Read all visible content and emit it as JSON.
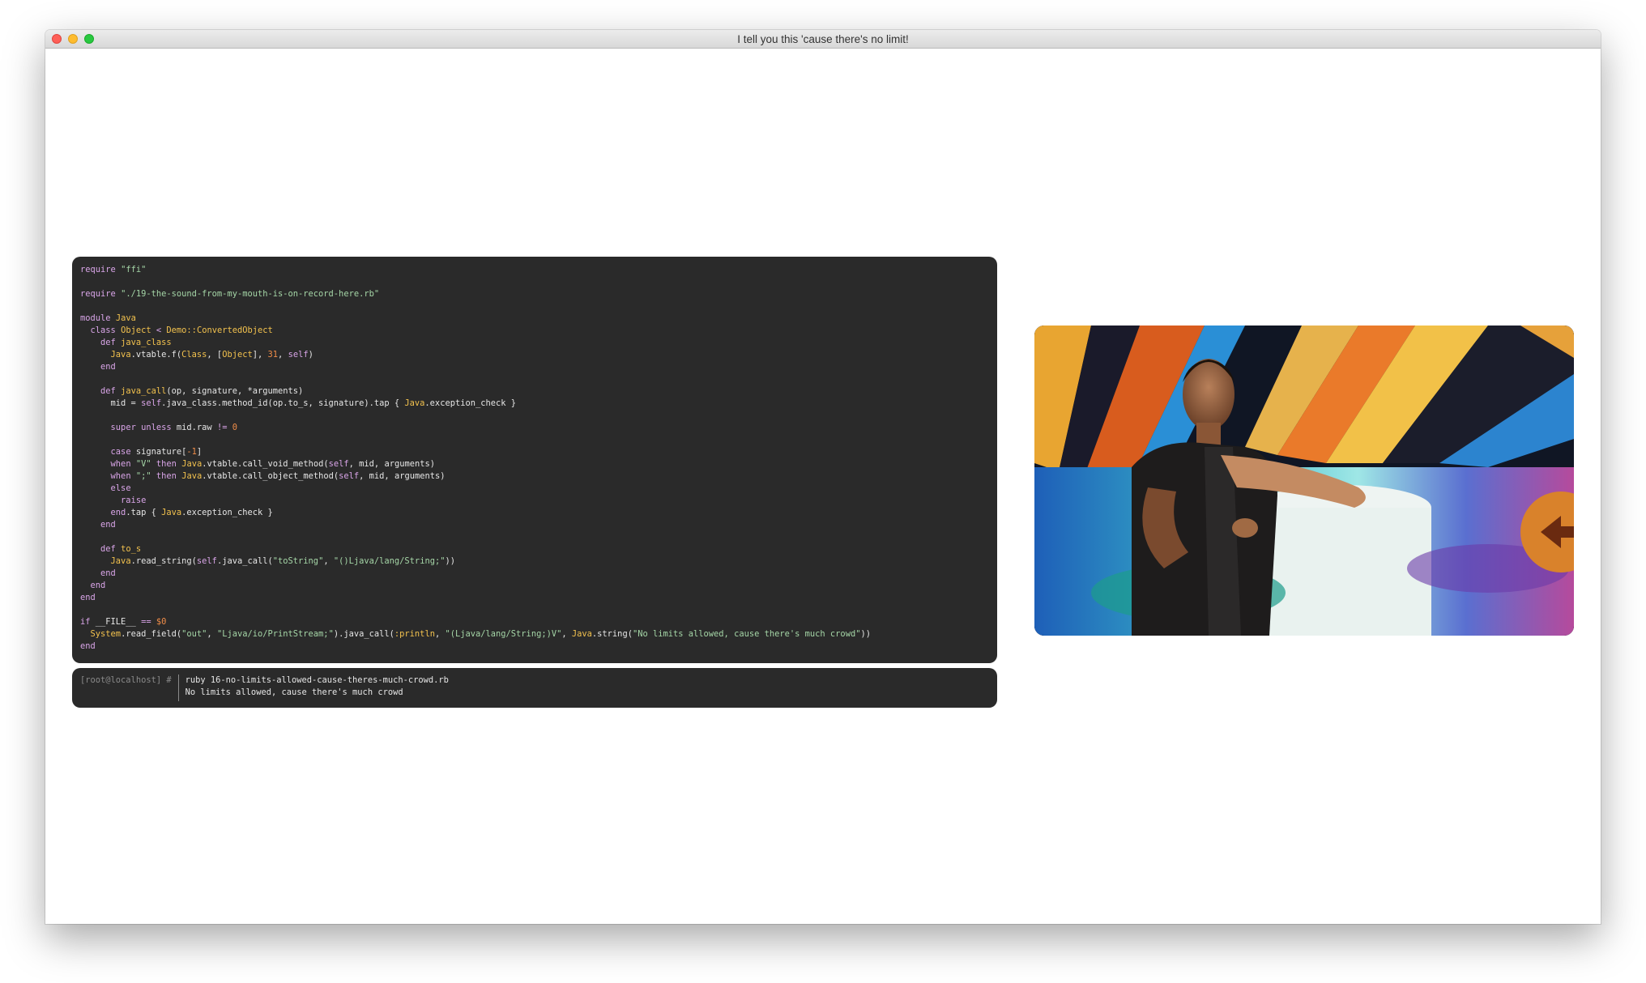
{
  "window": {
    "title": "I tell you this 'cause there's no limit!",
    "controls": [
      "close",
      "minimize",
      "zoom"
    ]
  },
  "colors": {
    "code_bg": "#2a2a2a",
    "keyword": "#d9a5e8",
    "constant": "#f3c24e",
    "string": "#a5d6a7",
    "number": "#f08d49",
    "prompt": "#8a8a8a"
  },
  "code": {
    "language": "ruby",
    "lines": [
      [
        [
          "kw",
          "require"
        ],
        [
          "plain",
          " "
        ],
        [
          "str",
          "\"ffi\""
        ]
      ],
      [],
      [
        [
          "kw",
          "require"
        ],
        [
          "plain",
          " "
        ],
        [
          "str",
          "\"./19-the-sound-from-my-mouth-is-on-record-here.rb\""
        ]
      ],
      [],
      [
        [
          "kw",
          "module"
        ],
        [
          "plain",
          " "
        ],
        [
          "const",
          "Java"
        ]
      ],
      [
        [
          "plain",
          "  "
        ],
        [
          "kw",
          "class"
        ],
        [
          "plain",
          " "
        ],
        [
          "const",
          "Object"
        ],
        [
          "plain",
          " "
        ],
        [
          "kw",
          "<"
        ],
        [
          "plain",
          " "
        ],
        [
          "const",
          "Demo::ConvertedObject"
        ]
      ],
      [
        [
          "plain",
          "    "
        ],
        [
          "kw",
          "def"
        ],
        [
          "plain",
          " "
        ],
        [
          "method",
          "java_class"
        ]
      ],
      [
        [
          "plain",
          "      "
        ],
        [
          "const",
          "Java"
        ],
        [
          "plain",
          ".vtable.f("
        ],
        [
          "const",
          "Class"
        ],
        [
          "plain",
          ", ["
        ],
        [
          "const",
          "Object"
        ],
        [
          "plain",
          "], "
        ],
        [
          "num",
          "31"
        ],
        [
          "plain",
          ", "
        ],
        [
          "kw",
          "self"
        ],
        [
          "plain",
          ")"
        ]
      ],
      [
        [
          "plain",
          "    "
        ],
        [
          "kw",
          "end"
        ]
      ],
      [],
      [
        [
          "plain",
          "    "
        ],
        [
          "kw",
          "def"
        ],
        [
          "plain",
          " "
        ],
        [
          "method",
          "java_call"
        ],
        [
          "plain",
          "(op, signature, *arguments)"
        ]
      ],
      [
        [
          "plain",
          "      mid = "
        ],
        [
          "kw",
          "self"
        ],
        [
          "plain",
          ".java_class.method_id(op.to_s, signature).tap { "
        ],
        [
          "const",
          "Java"
        ],
        [
          "plain",
          ".exception_check }"
        ]
      ],
      [],
      [
        [
          "plain",
          "      "
        ],
        [
          "kw",
          "super"
        ],
        [
          "plain",
          " "
        ],
        [
          "kw",
          "unless"
        ],
        [
          "plain",
          " mid.raw "
        ],
        [
          "kw",
          "!="
        ],
        [
          "plain",
          " "
        ],
        [
          "num",
          "0"
        ]
      ],
      [],
      [
        [
          "plain",
          "      "
        ],
        [
          "kw",
          "case"
        ],
        [
          "plain",
          " signature["
        ],
        [
          "num",
          "-1"
        ],
        [
          "plain",
          "]"
        ]
      ],
      [
        [
          "plain",
          "      "
        ],
        [
          "kw",
          "when"
        ],
        [
          "plain",
          " "
        ],
        [
          "str",
          "\"V\""
        ],
        [
          "plain",
          " "
        ],
        [
          "kw",
          "then"
        ],
        [
          "plain",
          " "
        ],
        [
          "const",
          "Java"
        ],
        [
          "plain",
          ".vtable.call_void_method("
        ],
        [
          "kw",
          "self"
        ],
        [
          "plain",
          ", mid, arguments)"
        ]
      ],
      [
        [
          "plain",
          "      "
        ],
        [
          "kw",
          "when"
        ],
        [
          "plain",
          " "
        ],
        [
          "str",
          "\";\""
        ],
        [
          "plain",
          " "
        ],
        [
          "kw",
          "then"
        ],
        [
          "plain",
          " "
        ],
        [
          "const",
          "Java"
        ],
        [
          "plain",
          ".vtable.call_object_method("
        ],
        [
          "kw",
          "self"
        ],
        [
          "plain",
          ", mid, arguments)"
        ]
      ],
      [
        [
          "plain",
          "      "
        ],
        [
          "kw",
          "else"
        ]
      ],
      [
        [
          "plain",
          "        "
        ],
        [
          "kw",
          "raise"
        ]
      ],
      [
        [
          "plain",
          "      "
        ],
        [
          "kw",
          "end"
        ],
        [
          "plain",
          ".tap { "
        ],
        [
          "const",
          "Java"
        ],
        [
          "plain",
          ".exception_check }"
        ]
      ],
      [
        [
          "plain",
          "    "
        ],
        [
          "kw",
          "end"
        ]
      ],
      [],
      [
        [
          "plain",
          "    "
        ],
        [
          "kw",
          "def"
        ],
        [
          "plain",
          " "
        ],
        [
          "method",
          "to_s"
        ]
      ],
      [
        [
          "plain",
          "      "
        ],
        [
          "const",
          "Java"
        ],
        [
          "plain",
          ".read_string("
        ],
        [
          "kw",
          "self"
        ],
        [
          "plain",
          ".java_call("
        ],
        [
          "str",
          "\"toString\""
        ],
        [
          "plain",
          ", "
        ],
        [
          "str",
          "\"()Ljava/lang/String;\""
        ],
        [
          "plain",
          "))"
        ]
      ],
      [
        [
          "plain",
          "    "
        ],
        [
          "kw",
          "end"
        ]
      ],
      [
        [
          "plain",
          "  "
        ],
        [
          "kw",
          "end"
        ]
      ],
      [
        [
          "kw",
          "end"
        ]
      ],
      [],
      [
        [
          "kw",
          "if"
        ],
        [
          "plain",
          " __FILE__ "
        ],
        [
          "kw",
          "=="
        ],
        [
          "plain",
          " "
        ],
        [
          "num",
          "$0"
        ]
      ],
      [
        [
          "plain",
          "  "
        ],
        [
          "const",
          "System"
        ],
        [
          "plain",
          ".read_field("
        ],
        [
          "str",
          "\"out\""
        ],
        [
          "plain",
          ", "
        ],
        [
          "str",
          "\"Ljava/io/PrintStream;\""
        ],
        [
          "plain",
          ").java_call("
        ],
        [
          "sym",
          ":println"
        ],
        [
          "plain",
          ", "
        ],
        [
          "str",
          "\"(Ljava/lang/String;)V\""
        ],
        [
          "plain",
          ", "
        ],
        [
          "const",
          "Java"
        ],
        [
          "plain",
          ".string("
        ],
        [
          "str",
          "\"No limits allowed, cause there's much crowd\""
        ],
        [
          "plain",
          "))"
        ]
      ],
      [
        [
          "kw",
          "end"
        ]
      ]
    ]
  },
  "terminal": {
    "prompt": "[root@localhost] #",
    "command": "ruby 16-no-limits-allowed-cause-theres-much-crowd.rb",
    "output": "No limits allowed, cause there's much crowd"
  }
}
